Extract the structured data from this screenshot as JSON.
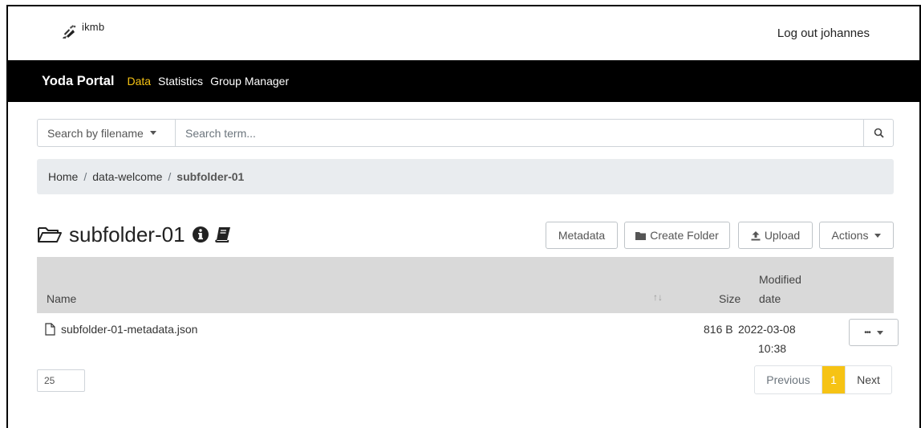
{
  "header": {
    "logo_text": "ikmb",
    "logout_label": "Log out johannes"
  },
  "nav": {
    "brand": "Yoda Portal",
    "links": [
      "Data",
      "Statistics",
      "Group Manager"
    ],
    "active": "Data",
    "accent_color": "#f6c314"
  },
  "search": {
    "type_label": "Search by filename",
    "placeholder": "Search term...",
    "button_icon": "search-icon"
  },
  "breadcrumb": {
    "items": [
      "Home",
      "data-welcome",
      "subfolder-01"
    ]
  },
  "folder": {
    "title": "subfolder-01",
    "icons": [
      "folder-open-icon",
      "info-circle-icon",
      "book-icon"
    ]
  },
  "toolbar": {
    "metadata_label": "Metadata",
    "create_folder_label": "Create Folder",
    "upload_label": "Upload",
    "actions_label": "Actions"
  },
  "table": {
    "columns": {
      "name": "Name",
      "size": "Size",
      "modified_line1": "Modified",
      "modified_line2": "date"
    },
    "rows": [
      {
        "name": "subfolder-01-metadata.json",
        "size": "816 B",
        "date": "2022-03-08",
        "time": "10:38",
        "menu_label": "•••"
      }
    ]
  },
  "footer": {
    "page_size": "25",
    "previous_label": "Previous",
    "current_page": "1",
    "next_label": "Next"
  }
}
